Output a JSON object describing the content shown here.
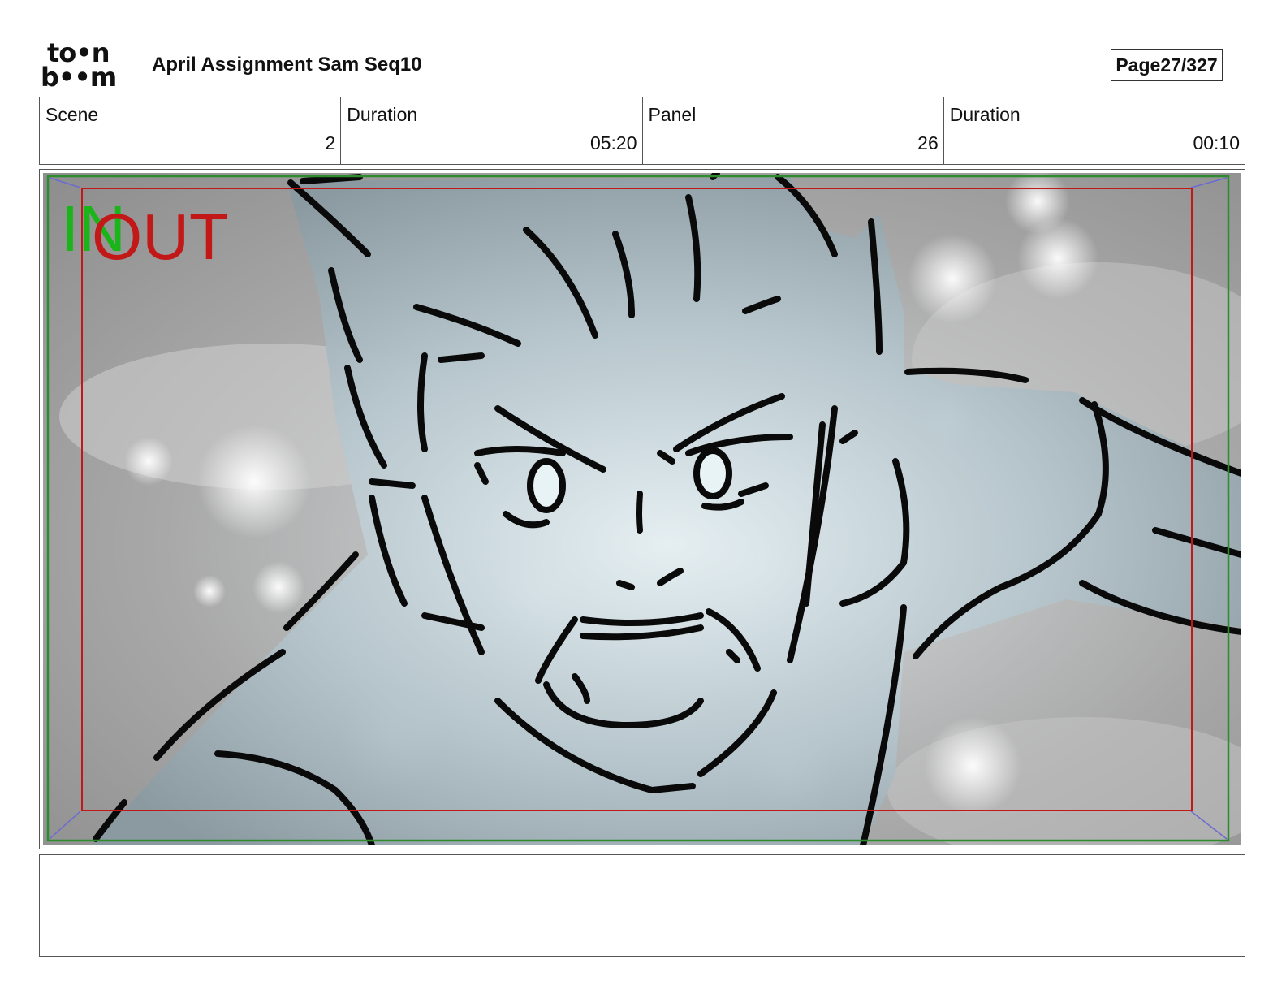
{
  "header": {
    "logo_top": "to•n",
    "logo_bottom": "b••m",
    "title": "April Assignment Sam Seq10",
    "page_label": "Page",
    "page_value": "27/327"
  },
  "info": [
    {
      "label": "Scene",
      "value": "2"
    },
    {
      "label": "Duration",
      "value": "05:20"
    },
    {
      "label": "Panel",
      "value": "26"
    },
    {
      "label": "Duration",
      "value": "00:10"
    }
  ],
  "panel": {
    "in_label": "IN",
    "out_label": "OUT",
    "colors": {
      "safe_frame": "#c21818",
      "camera_frame": "#2e8b2e",
      "in_text": "#19b519",
      "out_text": "#c21818",
      "background": "#9b9b9b",
      "figure_fill": "#a9bcc4"
    }
  },
  "caption": {
    "text": ""
  }
}
